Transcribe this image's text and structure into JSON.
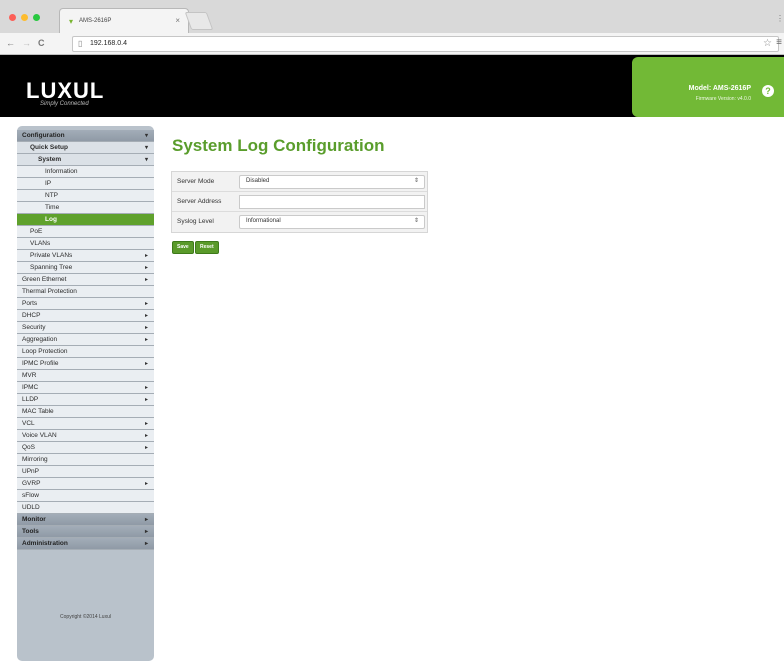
{
  "browser": {
    "tab_title": "AMS-2616P",
    "url": "192.168.0.4"
  },
  "colors": {
    "brand_green": "#72b936",
    "title_green": "#5a9d2c",
    "header_bg": "#000000"
  },
  "header": {
    "logo": "LUXUL",
    "tagline": "Simply Connected",
    "model": "Model: AMS-2616P",
    "firmware": "Firmware Version: v4.0.0"
  },
  "sidebar": {
    "items": [
      {
        "label": "Configuration",
        "arrow": "▾"
      },
      {
        "label": "Quick Setup",
        "arrow": "▾"
      },
      {
        "label": "System",
        "arrow": "▾"
      },
      {
        "label": "Information",
        "arrow": ""
      },
      {
        "label": "IP",
        "arrow": ""
      },
      {
        "label": "NTP",
        "arrow": ""
      },
      {
        "label": "Time",
        "arrow": ""
      },
      {
        "label": "Log",
        "arrow": ""
      },
      {
        "label": "PoE",
        "arrow": ""
      },
      {
        "label": "VLANs",
        "arrow": ""
      },
      {
        "label": "Private VLANs",
        "arrow": "▸"
      },
      {
        "label": "Spanning Tree",
        "arrow": "▸"
      },
      {
        "label": "Green Ethernet",
        "arrow": "▸"
      },
      {
        "label": "Thermal Protection",
        "arrow": ""
      },
      {
        "label": "Ports",
        "arrow": "▸"
      },
      {
        "label": "DHCP",
        "arrow": "▸"
      },
      {
        "label": "Security",
        "arrow": "▸"
      },
      {
        "label": "Aggregation",
        "arrow": "▸"
      },
      {
        "label": "Loop Protection",
        "arrow": ""
      },
      {
        "label": "IPMC Profile",
        "arrow": "▸"
      },
      {
        "label": "MVR",
        "arrow": ""
      },
      {
        "label": "IPMC",
        "arrow": "▸"
      },
      {
        "label": "LLDP",
        "arrow": "▸"
      },
      {
        "label": "MAC Table",
        "arrow": ""
      },
      {
        "label": "VCL",
        "arrow": "▸"
      },
      {
        "label": "Voice VLAN",
        "arrow": "▸"
      },
      {
        "label": "QoS",
        "arrow": "▸"
      },
      {
        "label": "Mirroring",
        "arrow": ""
      },
      {
        "label": "UPnP",
        "arrow": ""
      },
      {
        "label": "GVRP",
        "arrow": "▸"
      },
      {
        "label": "sFlow",
        "arrow": ""
      },
      {
        "label": "UDLD",
        "arrow": ""
      },
      {
        "label": "Monitor",
        "arrow": "▸"
      },
      {
        "label": "Tools",
        "arrow": "▸"
      },
      {
        "label": "Administration",
        "arrow": "▸"
      }
    ],
    "copyright": "Copyright ©2014 Luxul"
  },
  "main": {
    "title": "System Log Configuration",
    "fields": [
      {
        "label": "Server Mode",
        "value": "Disabled",
        "type": "select"
      },
      {
        "label": "Server Address",
        "value": "",
        "type": "input"
      },
      {
        "label": "Syslog Level",
        "value": "Informational",
        "type": "select"
      }
    ],
    "save_label": "Save",
    "reset_label": "Reset"
  }
}
